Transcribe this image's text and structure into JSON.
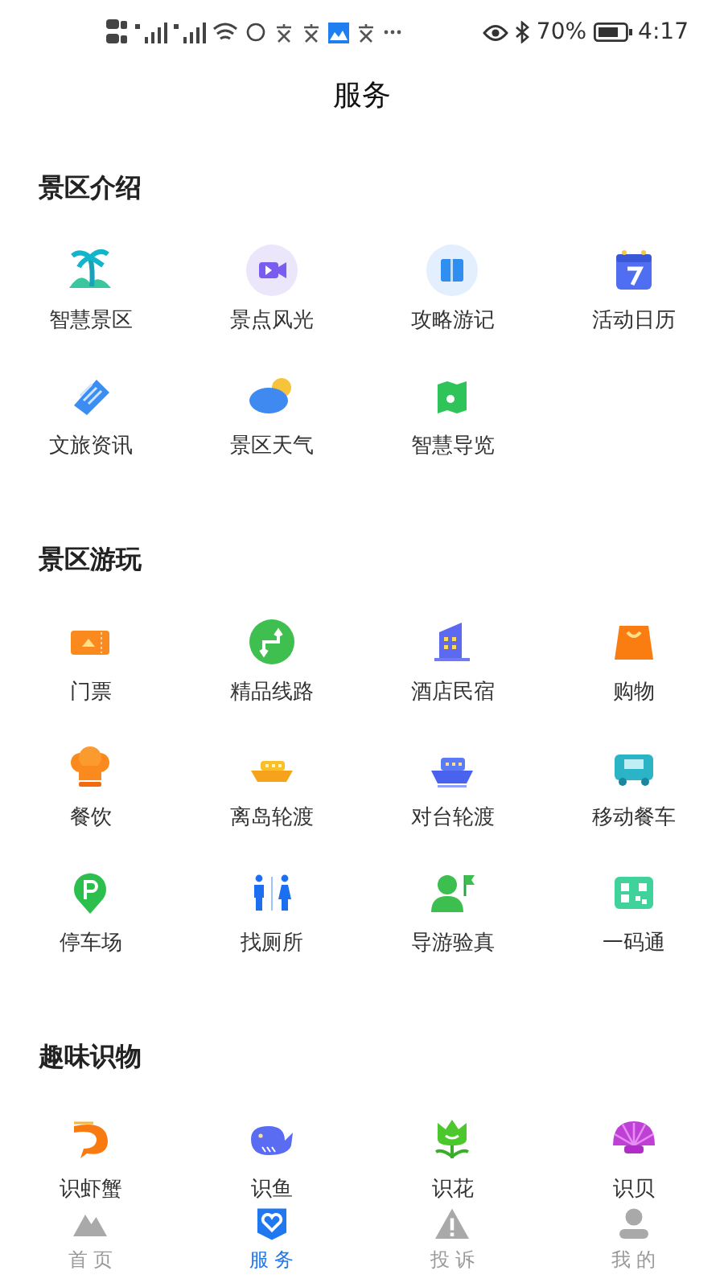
{
  "status_bar": {
    "battery": "70%",
    "time": "4:17"
  },
  "title": "服务",
  "sections": [
    {
      "title": "景区介绍",
      "items": [
        {
          "label": "智慧景区"
        },
        {
          "label": "景点风光"
        },
        {
          "label": "攻略游记"
        },
        {
          "label": "活动日历"
        },
        {
          "label": "文旅资讯"
        },
        {
          "label": "景区天气"
        },
        {
          "label": "智慧导览"
        }
      ]
    },
    {
      "title": "景区游玩",
      "items": [
        {
          "label": "门票"
        },
        {
          "label": "精品线路"
        },
        {
          "label": "酒店民宿"
        },
        {
          "label": "购物"
        },
        {
          "label": "餐饮"
        },
        {
          "label": "离岛轮渡"
        },
        {
          "label": "对台轮渡"
        },
        {
          "label": "移动餐车"
        },
        {
          "label": "停车场"
        },
        {
          "label": "找厕所"
        },
        {
          "label": "导游验真"
        },
        {
          "label": "一码通"
        }
      ]
    },
    {
      "title": "趣味识物",
      "items": [
        {
          "label": "识虾蟹"
        },
        {
          "label": "识鱼"
        },
        {
          "label": "识花"
        },
        {
          "label": "识贝"
        }
      ]
    }
  ],
  "tabs": [
    {
      "label": "首 页",
      "selected": false
    },
    {
      "label": "服 务",
      "selected": true
    },
    {
      "label": "投 诉",
      "selected": false
    },
    {
      "label": "我 的",
      "selected": false
    }
  ]
}
